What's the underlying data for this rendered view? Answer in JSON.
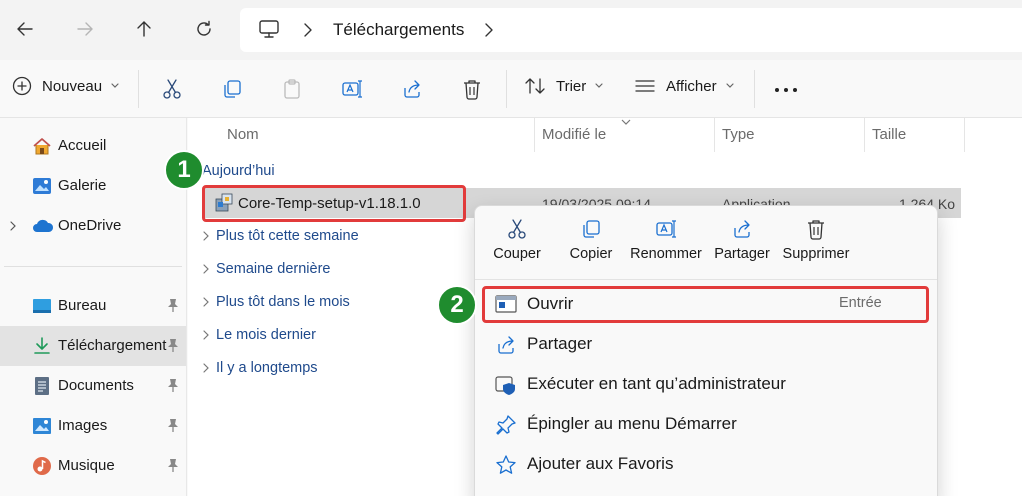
{
  "address": {
    "path_segment": "Téléchargements"
  },
  "commands": {
    "new_label": "Nouveau",
    "sort_label": "Trier",
    "view_label": "Afficher"
  },
  "sidebar": {
    "items": [
      {
        "label": "Accueil"
      },
      {
        "label": "Galerie"
      },
      {
        "label": "OneDrive"
      },
      {
        "label": "Bureau"
      },
      {
        "label": "Téléchargement"
      },
      {
        "label": "Documents"
      },
      {
        "label": "Images"
      },
      {
        "label": "Musique"
      }
    ]
  },
  "columns": {
    "name": "Nom",
    "modified": "Modifié le",
    "type": "Type",
    "size": "Taille"
  },
  "groups": {
    "today": "Aujourd’hui",
    "earlier_week": "Plus tôt cette semaine",
    "last_week": "Semaine dernière",
    "earlier_month": "Plus tôt dans le mois",
    "last_month": "Le mois dernier",
    "long_ago": "Il y a longtemps"
  },
  "file": {
    "name": "Core-Temp-setup-v1.18.1.0",
    "date": "19/03/2025 09:14",
    "type": "Application",
    "size": "1 264 Ko"
  },
  "badges": {
    "one": "1",
    "two": "2"
  },
  "context_menu": {
    "quick_actions": [
      {
        "label": "Couper"
      },
      {
        "label": "Copier"
      },
      {
        "label": "Renommer"
      },
      {
        "label": "Partager"
      },
      {
        "label": "Supprimer"
      }
    ],
    "items": [
      {
        "label": "Ouvrir",
        "shortcut": "Entrée"
      },
      {
        "label": "Partager"
      },
      {
        "label": "Exécuter en tant qu’administrateur"
      },
      {
        "label": "Épingler au menu Démarrer"
      },
      {
        "label": "Ajouter aux Favoris"
      }
    ]
  },
  "colors": {
    "highlight_red": "#e23b3b",
    "badge_green": "#1f8c2e",
    "link_blue": "#1f4a8c",
    "accent_blue": "#0067c0"
  }
}
